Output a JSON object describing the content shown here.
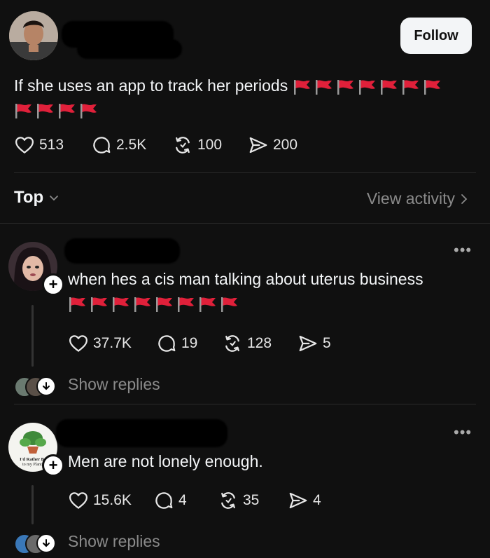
{
  "post": {
    "text": "If she uses an app to track her periods",
    "follow_label": "Follow",
    "likes": "513",
    "comments": "2.5K",
    "reposts": "100",
    "shares": "200"
  },
  "sort": {
    "label": "Top",
    "view_activity": "View activity"
  },
  "replies": [
    {
      "text": "when hes a cis man talking about uterus business",
      "likes": "37.7K",
      "comments": "19",
      "reposts": "128",
      "shares": "5",
      "show_replies": "Show replies"
    },
    {
      "text": "Men are not lonely enough.",
      "likes": "15.6K",
      "comments": "4",
      "reposts": "35",
      "shares": "4",
      "show_replies": "Show replies"
    }
  ],
  "avatar2_text": "I'd Rather Be Talking to my Plants",
  "colors": {
    "background": "#101010",
    "text": "#f3f5f7",
    "muted": "#8a8a8a",
    "flag_red": "#e0203a"
  },
  "icons": [
    "heart-icon",
    "comment-icon",
    "repost-icon",
    "share-icon",
    "chevron-down-icon",
    "chevron-right-icon",
    "more-icon",
    "plus-icon",
    "red-flag-emoji"
  ]
}
